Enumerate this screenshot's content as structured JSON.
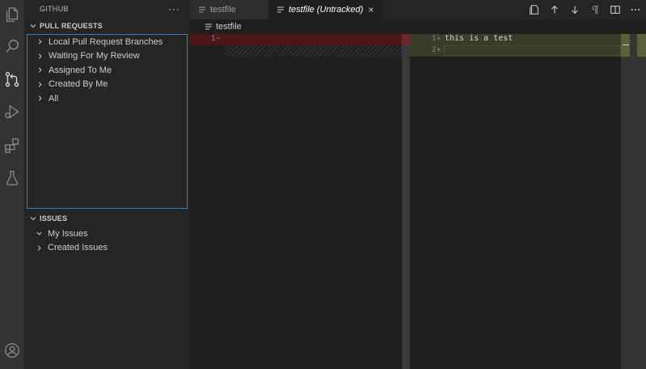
{
  "activity_bar": {
    "icons": [
      "explorer-icon",
      "search-icon",
      "source-control-icon",
      "run-debug-icon",
      "extensions-icon",
      "testing-icon",
      "account-icon"
    ]
  },
  "sidebar": {
    "title": "GITHUB",
    "more": "···",
    "pull_requests": {
      "header": "PULL REQUESTS",
      "items": [
        {
          "label": "Local Pull Request Branches"
        },
        {
          "label": "Waiting For My Review"
        },
        {
          "label": "Assigned To Me"
        },
        {
          "label": "Created By Me"
        },
        {
          "label": "All"
        }
      ]
    },
    "issues": {
      "header": "ISSUES",
      "items": [
        {
          "label": "My Issues",
          "expanded": true
        },
        {
          "label": "Created Issues",
          "expanded": false
        }
      ]
    }
  },
  "tabs": [
    {
      "label": "testfile",
      "active": false
    },
    {
      "label": "testfile (Untracked)",
      "active": true,
      "close": "×"
    }
  ],
  "editor_actions": [
    "open-changes-icon",
    "arrow-up-icon",
    "arrow-down-icon",
    "pilcrow-icon",
    "split-editor-icon",
    "more-icon"
  ],
  "breadcrumb": {
    "file": "testfile"
  },
  "diff": {
    "left": {
      "lines": [
        {
          "num": "1",
          "marker": "−",
          "text": ""
        }
      ]
    },
    "right": {
      "lines": [
        {
          "num": "1",
          "marker": "+",
          "text": "this is a test"
        },
        {
          "num": "2",
          "marker": "+",
          "text": ""
        }
      ]
    }
  },
  "colors": {
    "removed_bg": "#4b1818",
    "added_bg": "#373d29",
    "focus_border": "#3a7ab8"
  }
}
